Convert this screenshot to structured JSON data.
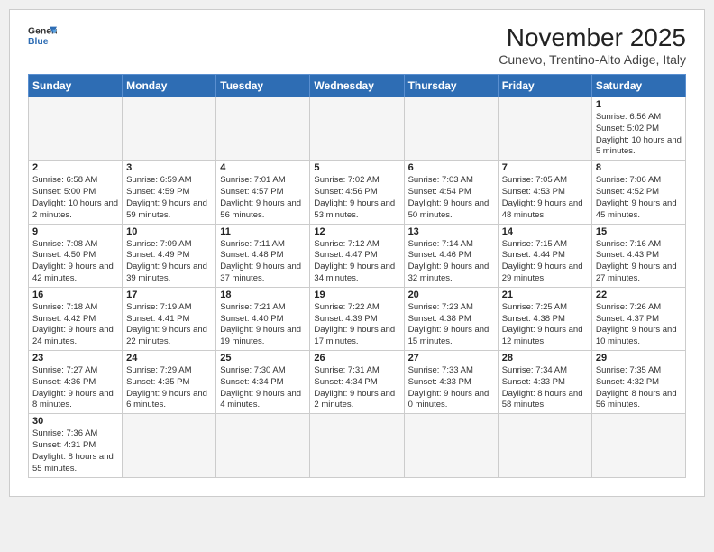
{
  "logo": {
    "line1": "General",
    "line2": "Blue"
  },
  "title": "November 2025",
  "location": "Cunevo, Trentino-Alto Adige, Italy",
  "days_of_week": [
    "Sunday",
    "Monday",
    "Tuesday",
    "Wednesday",
    "Thursday",
    "Friday",
    "Saturday"
  ],
  "weeks": [
    [
      {
        "day": "",
        "info": ""
      },
      {
        "day": "",
        "info": ""
      },
      {
        "day": "",
        "info": ""
      },
      {
        "day": "",
        "info": ""
      },
      {
        "day": "",
        "info": ""
      },
      {
        "day": "",
        "info": ""
      },
      {
        "day": "1",
        "info": "Sunrise: 6:56 AM\nSunset: 5:02 PM\nDaylight: 10 hours and 5 minutes."
      }
    ],
    [
      {
        "day": "2",
        "info": "Sunrise: 6:58 AM\nSunset: 5:00 PM\nDaylight: 10 hours and 2 minutes."
      },
      {
        "day": "3",
        "info": "Sunrise: 6:59 AM\nSunset: 4:59 PM\nDaylight: 9 hours and 59 minutes."
      },
      {
        "day": "4",
        "info": "Sunrise: 7:01 AM\nSunset: 4:57 PM\nDaylight: 9 hours and 56 minutes."
      },
      {
        "day": "5",
        "info": "Sunrise: 7:02 AM\nSunset: 4:56 PM\nDaylight: 9 hours and 53 minutes."
      },
      {
        "day": "6",
        "info": "Sunrise: 7:03 AM\nSunset: 4:54 PM\nDaylight: 9 hours and 50 minutes."
      },
      {
        "day": "7",
        "info": "Sunrise: 7:05 AM\nSunset: 4:53 PM\nDaylight: 9 hours and 48 minutes."
      },
      {
        "day": "8",
        "info": "Sunrise: 7:06 AM\nSunset: 4:52 PM\nDaylight: 9 hours and 45 minutes."
      }
    ],
    [
      {
        "day": "9",
        "info": "Sunrise: 7:08 AM\nSunset: 4:50 PM\nDaylight: 9 hours and 42 minutes."
      },
      {
        "day": "10",
        "info": "Sunrise: 7:09 AM\nSunset: 4:49 PM\nDaylight: 9 hours and 39 minutes."
      },
      {
        "day": "11",
        "info": "Sunrise: 7:11 AM\nSunset: 4:48 PM\nDaylight: 9 hours and 37 minutes."
      },
      {
        "day": "12",
        "info": "Sunrise: 7:12 AM\nSunset: 4:47 PM\nDaylight: 9 hours and 34 minutes."
      },
      {
        "day": "13",
        "info": "Sunrise: 7:14 AM\nSunset: 4:46 PM\nDaylight: 9 hours and 32 minutes."
      },
      {
        "day": "14",
        "info": "Sunrise: 7:15 AM\nSunset: 4:44 PM\nDaylight: 9 hours and 29 minutes."
      },
      {
        "day": "15",
        "info": "Sunrise: 7:16 AM\nSunset: 4:43 PM\nDaylight: 9 hours and 27 minutes."
      }
    ],
    [
      {
        "day": "16",
        "info": "Sunrise: 7:18 AM\nSunset: 4:42 PM\nDaylight: 9 hours and 24 minutes."
      },
      {
        "day": "17",
        "info": "Sunrise: 7:19 AM\nSunset: 4:41 PM\nDaylight: 9 hours and 22 minutes."
      },
      {
        "day": "18",
        "info": "Sunrise: 7:21 AM\nSunset: 4:40 PM\nDaylight: 9 hours and 19 minutes."
      },
      {
        "day": "19",
        "info": "Sunrise: 7:22 AM\nSunset: 4:39 PM\nDaylight: 9 hours and 17 minutes."
      },
      {
        "day": "20",
        "info": "Sunrise: 7:23 AM\nSunset: 4:38 PM\nDaylight: 9 hours and 15 minutes."
      },
      {
        "day": "21",
        "info": "Sunrise: 7:25 AM\nSunset: 4:38 PM\nDaylight: 9 hours and 12 minutes."
      },
      {
        "day": "22",
        "info": "Sunrise: 7:26 AM\nSunset: 4:37 PM\nDaylight: 9 hours and 10 minutes."
      }
    ],
    [
      {
        "day": "23",
        "info": "Sunrise: 7:27 AM\nSunset: 4:36 PM\nDaylight: 9 hours and 8 minutes."
      },
      {
        "day": "24",
        "info": "Sunrise: 7:29 AM\nSunset: 4:35 PM\nDaylight: 9 hours and 6 minutes."
      },
      {
        "day": "25",
        "info": "Sunrise: 7:30 AM\nSunset: 4:34 PM\nDaylight: 9 hours and 4 minutes."
      },
      {
        "day": "26",
        "info": "Sunrise: 7:31 AM\nSunset: 4:34 PM\nDaylight: 9 hours and 2 minutes."
      },
      {
        "day": "27",
        "info": "Sunrise: 7:33 AM\nSunset: 4:33 PM\nDaylight: 9 hours and 0 minutes."
      },
      {
        "day": "28",
        "info": "Sunrise: 7:34 AM\nSunset: 4:33 PM\nDaylight: 8 hours and 58 minutes."
      },
      {
        "day": "29",
        "info": "Sunrise: 7:35 AM\nSunset: 4:32 PM\nDaylight: 8 hours and 56 minutes."
      }
    ],
    [
      {
        "day": "30",
        "info": "Sunrise: 7:36 AM\nSunset: 4:31 PM\nDaylight: 8 hours and 55 minutes."
      },
      {
        "day": "",
        "info": ""
      },
      {
        "day": "",
        "info": ""
      },
      {
        "day": "",
        "info": ""
      },
      {
        "day": "",
        "info": ""
      },
      {
        "day": "",
        "info": ""
      },
      {
        "day": "",
        "info": ""
      }
    ]
  ]
}
